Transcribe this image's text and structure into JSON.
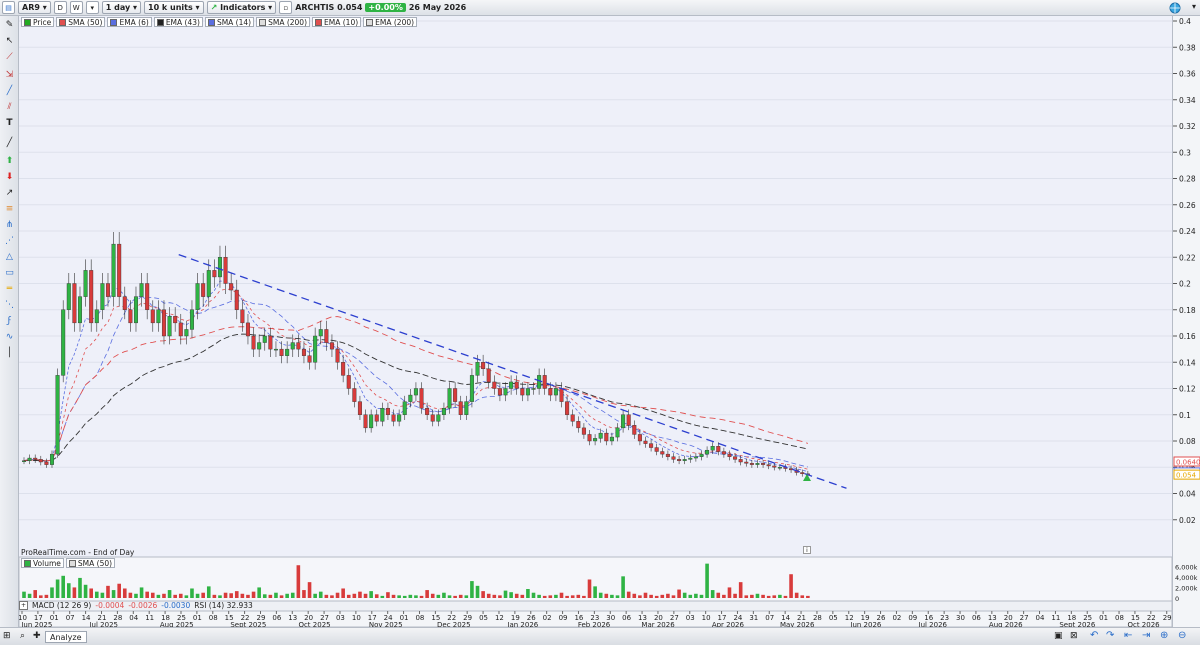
{
  "toolbar": {
    "ticker": "AR9",
    "period_d": "D",
    "period_w": "W",
    "interval": "1 day",
    "units": "10 k units",
    "indicators_label": "Indicators",
    "instrument": "ARCHTIS 0.054",
    "change": "+0.00%",
    "date": "26 May 2026"
  },
  "legend": [
    {
      "label": "Price",
      "color": "#22aa22"
    },
    {
      "label": "SMA (50)",
      "color": "#e05050"
    },
    {
      "label": "EMA (6)",
      "color": "#5a6ee0"
    },
    {
      "label": "EMA (43)",
      "color": "#222222"
    },
    {
      "label": "SMA (14)",
      "color": "#5a6ee0"
    },
    {
      "label": "SMA (200)",
      "color": "#dddddd"
    },
    {
      "label": "EMA (10)",
      "color": "#e05050"
    },
    {
      "label": "EMA (200)",
      "color": "#dddddd"
    }
  ],
  "watermark": "ProRealTime.com - End of Day",
  "price_axis": {
    "ticks": [
      "0.4",
      "0.38",
      "0.36",
      "0.34",
      "0.32",
      "0.3",
      "0.28",
      "0.26",
      "0.24",
      "0.22",
      "0.2",
      "0.18",
      "0.16",
      "0.14",
      "0.12",
      "0.1",
      "0.08",
      "0.06",
      "0.04",
      "0.02"
    ],
    "labels": [
      {
        "text": "0.0640",
        "value": 0.064,
        "color": "#e05050"
      },
      {
        "text": "0.0557",
        "value": 0.0557,
        "color": "#5a6ee0"
      },
      {
        "text": "0.054",
        "value": 0.054,
        "color": "#e6a800"
      }
    ]
  },
  "volume_panel": {
    "legend": [
      {
        "label": "Volume",
        "color": "#2fb344"
      },
      {
        "label": "SMA (50)",
        "color": "#dddddd"
      }
    ],
    "ticks": [
      "6,000k",
      "4,000k",
      "2,000k",
      "0"
    ]
  },
  "macd_panel": {
    "label": "MACD (12 26 9)",
    "v1": "-0.0004",
    "v2": "-0.0026",
    "v3": "-0.0030",
    "rsi_label": "RSI (14) 32.933"
  },
  "x_axis": {
    "days": [
      "10",
      "17",
      "01",
      "07",
      "14",
      "21",
      "28",
      "04",
      "11",
      "18",
      "25",
      "01",
      "08",
      "15",
      "22",
      "29",
      "06",
      "13",
      "20",
      "27",
      "03",
      "10",
      "17",
      "24",
      "01",
      "08",
      "15",
      "22",
      "29",
      "05",
      "12",
      "19",
      "26",
      "02",
      "09",
      "16",
      "23",
      "30",
      "06",
      "13",
      "20",
      "27",
      "03",
      "10",
      "17",
      "24",
      "31",
      "07",
      "14",
      "21",
      "28",
      "05",
      "12",
      "19",
      "26",
      "02",
      "09",
      "16",
      "23",
      "30",
      "06",
      "13",
      "20",
      "27",
      "04",
      "11",
      "18",
      "25",
      "01",
      "08",
      "15",
      "22",
      "29",
      "05",
      "12",
      "19",
      "26",
      "03",
      "10",
      "17",
      "24",
      "31",
      "07",
      "14",
      "21",
      "28"
    ],
    "months": [
      "Jun 2025",
      "Jul 2025",
      "Aug 2025",
      "Sept 2025",
      "Oct 2025",
      "Nov 2025",
      "Dec 2025",
      "Jan 2026",
      "Feb 2026",
      "Mar 2026",
      "Apr 2026",
      "May 2026",
      "Jun 2026",
      "Jul 2026",
      "Aug 2026",
      "Sept 2026",
      "Oct 2026"
    ]
  },
  "footer": {
    "analyze_label": "Analyze"
  },
  "chart_data": {
    "type": "candlestick",
    "x_start": "10 Jun 2025",
    "x_end": "28 Oct 2026",
    "ylim": [
      0.0,
      0.4
    ],
    "closes": [
      0.065,
      0.067,
      0.066,
      0.064,
      0.062,
      0.07,
      0.13,
      0.18,
      0.2,
      0.17,
      0.19,
      0.21,
      0.17,
      0.18,
      0.2,
      0.19,
      0.23,
      0.19,
      0.18,
      0.17,
      0.19,
      0.2,
      0.18,
      0.17,
      0.18,
      0.16,
      0.175,
      0.17,
      0.16,
      0.165,
      0.18,
      0.2,
      0.19,
      0.21,
      0.205,
      0.22,
      0.2,
      0.195,
      0.18,
      0.17,
      0.16,
      0.15,
      0.155,
      0.16,
      0.15,
      0.15,
      0.145,
      0.15,
      0.155,
      0.15,
      0.145,
      0.14,
      0.16,
      0.165,
      0.155,
      0.15,
      0.14,
      0.13,
      0.12,
      0.11,
      0.1,
      0.09,
      0.1,
      0.095,
      0.105,
      0.1,
      0.095,
      0.1,
      0.11,
      0.115,
      0.12,
      0.105,
      0.1,
      0.095,
      0.1,
      0.105,
      0.12,
      0.11,
      0.1,
      0.11,
      0.13,
      0.14,
      0.135,
      0.125,
      0.12,
      0.115,
      0.12,
      0.125,
      0.12,
      0.115,
      0.12,
      0.12,
      0.13,
      0.12,
      0.115,
      0.12,
      0.11,
      0.1,
      0.095,
      0.09,
      0.085,
      0.08,
      0.082,
      0.086,
      0.08,
      0.083,
      0.09,
      0.1,
      0.092,
      0.085,
      0.08,
      0.078,
      0.075,
      0.072,
      0.07,
      0.068,
      0.066,
      0.065,
      0.066,
      0.067,
      0.068,
      0.07,
      0.073,
      0.076,
      0.072,
      0.07,
      0.068,
      0.066,
      0.064,
      0.063,
      0.062,
      0.063,
      0.062,
      0.061,
      0.06,
      0.06,
      0.059,
      0.058,
      0.056,
      0.055,
      0.054
    ],
    "volume": [
      1.2,
      0.8,
      1.5,
      0.5,
      0.6,
      2.0,
      3.5,
      4.2,
      2.8,
      2.0,
      3.8,
      2.5,
      1.8,
      1.2,
      1.0,
      2.3,
      1.5,
      2.7,
      1.8,
      1.0,
      0.8,
      2.0,
      1.2,
      1.0,
      0.6,
      0.8,
      1.5,
      0.6,
      0.8,
      0.5,
      1.8,
      0.8,
      1.0,
      2.2,
      0.6,
      0.5,
      1.0,
      0.9,
      1.3,
      0.8,
      0.6,
      1.2,
      2.0,
      0.7,
      0.6,
      1.0,
      0.5,
      0.8,
      1.0,
      6.2,
      1.5,
      3.0,
      0.8,
      1.2,
      0.6,
      0.5,
      1.0,
      1.8,
      0.6,
      0.8,
      1.2,
      0.8,
      1.3,
      0.7,
      0.4,
      1.1,
      0.6,
      0.5,
      0.4,
      0.6,
      0.5,
      0.4,
      1.5,
      0.8,
      0.6,
      1.0,
      0.5,
      0.4,
      0.6,
      0.5,
      3.2,
      2.3,
      1.3,
      0.8,
      0.6,
      0.5,
      1.4,
      1.1,
      0.8,
      0.6,
      1.7,
      1.0,
      0.6,
      0.4,
      0.5,
      0.6,
      1.0,
      0.4,
      0.5,
      0.6,
      0.4,
      3.5,
      2.2,
      1.0,
      0.8,
      0.6,
      0.5,
      4.1,
      1.2,
      0.8,
      0.5,
      1.0,
      0.6,
      0.4,
      0.6,
      0.8,
      0.5,
      1.6,
      1.0,
      0.6,
      0.8,
      0.6,
      6.5,
      1.5,
      1.0,
      0.6,
      2.0,
      0.8,
      3.0,
      0.5,
      0.6,
      0.8,
      0.6,
      0.4,
      0.5,
      0.6,
      0.4,
      4.5,
      1.0,
      0.5,
      0.4
    ],
    "trendline": {
      "from": {
        "date": "18 Aug 2025",
        "value": 0.222
      },
      "to": {
        "date": "08 Jun 2026",
        "value": 0.044
      }
    }
  }
}
